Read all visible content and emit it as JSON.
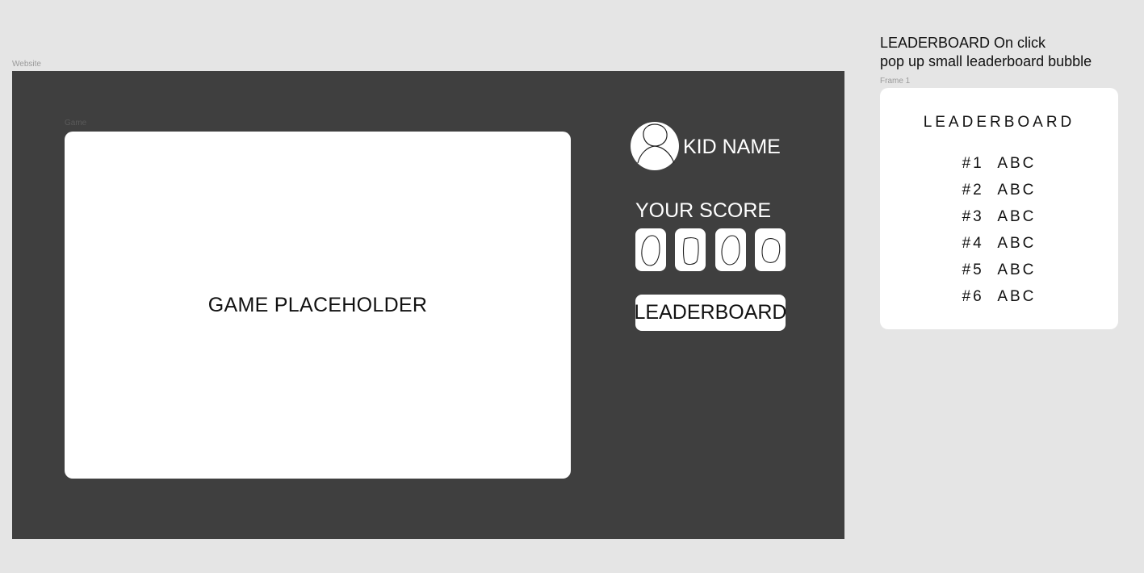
{
  "frames": {
    "website_label": "Website",
    "game_label": "Game",
    "popup_label": "Frame 1"
  },
  "game": {
    "placeholder_text": "GAME PLACEHOLDER"
  },
  "player": {
    "name": "KID NAME",
    "avatar_icon": "user-avatar-icon"
  },
  "score": {
    "label": "YOUR SCORE",
    "digits": [
      "0",
      "0",
      "0",
      "0"
    ]
  },
  "leaderboard_button": {
    "label": "LEADERBOARD"
  },
  "note": {
    "line1": "LEADERBOARD On click",
    "line2": "pop up small leaderboard bubble"
  },
  "popup": {
    "title": "LEADERBOARD",
    "entries": [
      {
        "rank": "#1",
        "name": "ABC"
      },
      {
        "rank": "#2",
        "name": "ABC"
      },
      {
        "rank": "#3",
        "name": "ABC"
      },
      {
        "rank": "#4",
        "name": "ABC"
      },
      {
        "rank": "#5",
        "name": "ABC"
      },
      {
        "rank": "#6",
        "name": "ABC"
      }
    ]
  },
  "colors": {
    "page_background": "#e5e5e5",
    "website_background": "#3f3f3f",
    "card_background": "#ffffff",
    "text_dark": "#111111",
    "text_light": "#ffffff"
  }
}
